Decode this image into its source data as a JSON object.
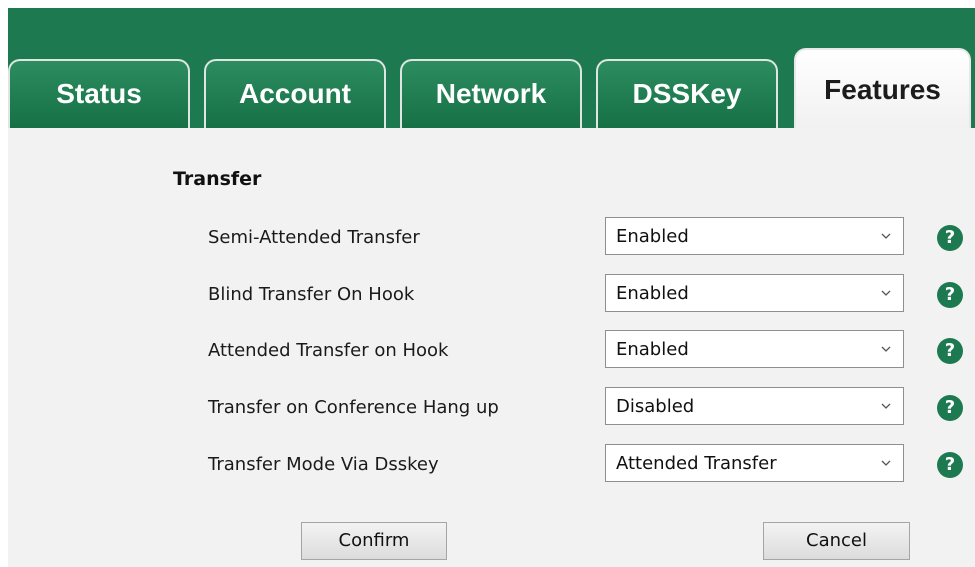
{
  "tabs": [
    {
      "label": "Status",
      "active": false
    },
    {
      "label": "Account",
      "active": false
    },
    {
      "label": "Network",
      "active": false
    },
    {
      "label": "DSSKey",
      "active": false
    },
    {
      "label": "Features",
      "active": true
    }
  ],
  "section": {
    "title": "Transfer"
  },
  "settings": [
    {
      "label": "Semi-Attended Transfer",
      "value": "Enabled"
    },
    {
      "label": "Blind Transfer On Hook",
      "value": "Enabled"
    },
    {
      "label": "Attended Transfer on Hook",
      "value": "Enabled"
    },
    {
      "label": "Transfer on Conference Hang up",
      "value": "Disabled"
    },
    {
      "label": "Transfer Mode Via Dsskey",
      "value": "Attended Transfer"
    }
  ],
  "help_glyph": "?",
  "buttons": {
    "confirm": "Confirm",
    "cancel": "Cancel"
  },
  "colors": {
    "brand_green": "#1d7a50",
    "panel_bg": "#f2f2f2"
  }
}
